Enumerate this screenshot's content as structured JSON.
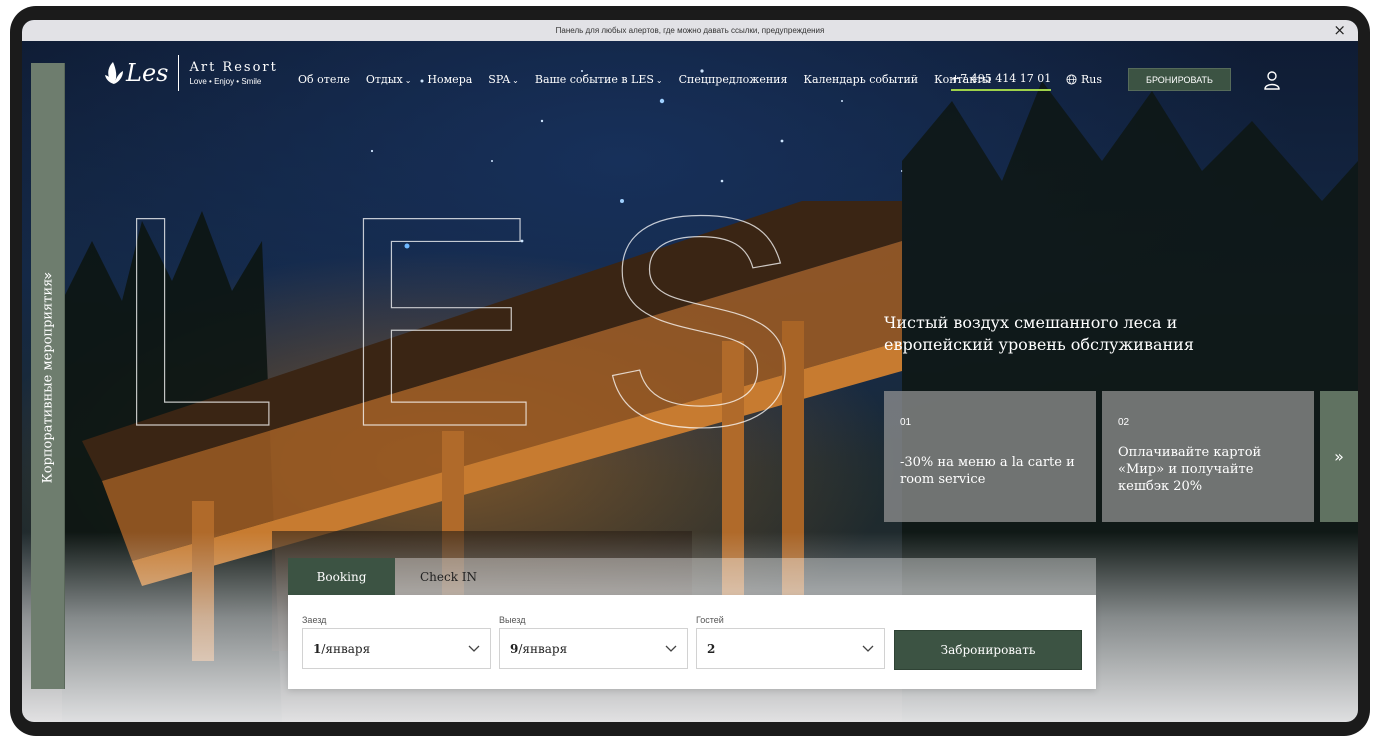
{
  "alert": {
    "text": "Панель для любых алертов, где можно давать ссылки, предупреждения",
    "close_icon": "close-icon"
  },
  "logo": {
    "les": "Les",
    "title": "Art Resort",
    "subtitle": "Love • Enjoy • Smile"
  },
  "nav": {
    "items": [
      {
        "label": "Об отеле",
        "dropdown": false
      },
      {
        "label": "Отдых",
        "dropdown": true
      },
      {
        "label": "Номера",
        "dropdown": false
      },
      {
        "label": "SPA",
        "dropdown": true
      },
      {
        "label": "Ваше событие в LES",
        "dropdown": true
      },
      {
        "label": "Спецпредложения",
        "dropdown": false
      },
      {
        "label": "Календарь событий",
        "dropdown": false
      },
      {
        "label": "Контакты",
        "dropdown": false
      }
    ],
    "chevron": "⌄"
  },
  "header": {
    "phone": "+7 495 414 17 01",
    "lang": "Rus",
    "book_label": "БРОНИРОВАТЬ"
  },
  "side": {
    "label": "Корпоративные мероприятия",
    "arrow": "»"
  },
  "hero": {
    "big_text": "LES",
    "tagline": "Чистый воздух смешанного леса и европейский уровень обслуживания"
  },
  "cards": [
    {
      "num": "01",
      "text": "-30% на меню a la carte и room service"
    },
    {
      "num": "02",
      "text": "Оплачивайте картой «Мир» и получайте кешбэк 20%"
    }
  ],
  "cards_next": "»",
  "booking": {
    "tabs": [
      "Booking",
      "Check IN"
    ],
    "checkin_label": "Заезд",
    "checkin_day": "1",
    "checkin_month": "/января",
    "checkout_label": "Выезд",
    "checkout_day": "9",
    "checkout_month": "/января",
    "guests_label": "Гостей",
    "guests_value": "2",
    "submit": "Забронировать"
  },
  "colors": {
    "accent_green": "#3c5343",
    "phone_underline": "#9fd24a",
    "side_bar": "#6e7d6e"
  }
}
